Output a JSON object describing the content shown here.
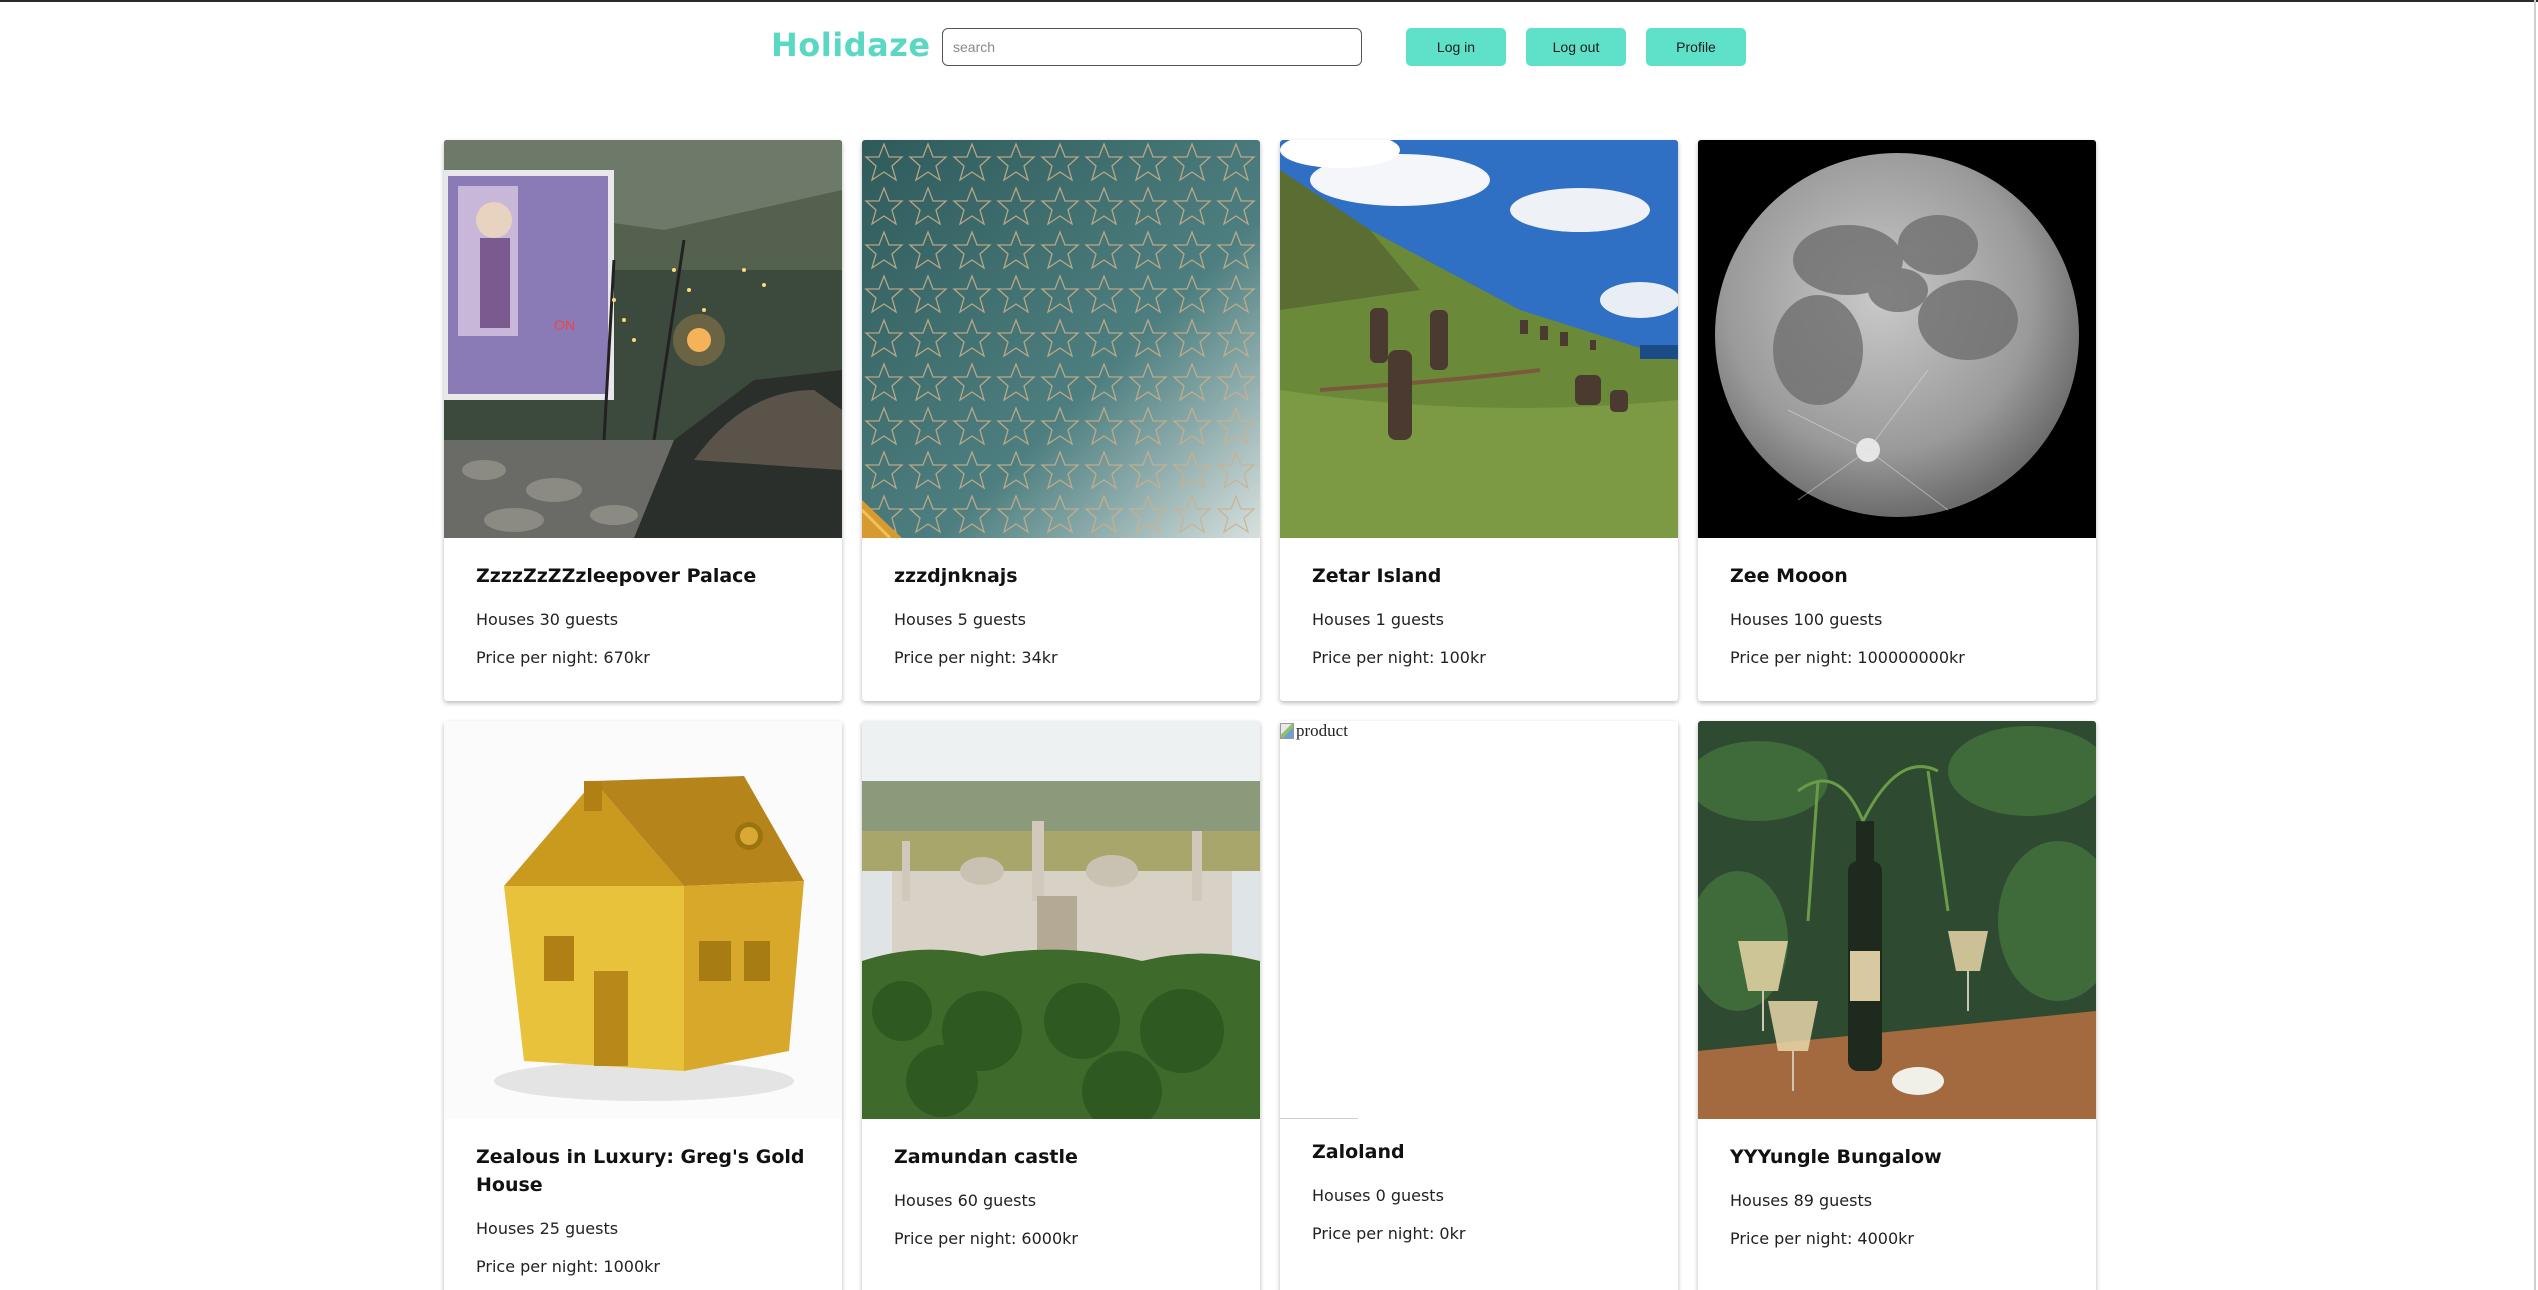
{
  "header": {
    "logo": "Holidaze",
    "search_placeholder": "search",
    "buttons": {
      "login": "Log in",
      "logout": "Log out",
      "profile": "Profile"
    }
  },
  "colors": {
    "brand": "#5ad8c4",
    "button": "#5ee0c9"
  },
  "cards": [
    {
      "title": "ZzzzZzZZzleepover Palace",
      "guests": "Houses 30 guests",
      "price": "Price per night: 670kr",
      "image": "outdoor-cinema-photo"
    },
    {
      "title": "zzzdjnknajs",
      "guests": "Houses 5 guests",
      "price": "Price per night: 34kr",
      "image": "star-pattern-wallpaper-photo"
    },
    {
      "title": "Zetar Island",
      "guests": "Houses 1 guests",
      "price": "Price per night: 100kr",
      "image": "moai-hillside-photo"
    },
    {
      "title": "Zee Mooon",
      "guests": "Houses 100 guests",
      "price": "Price per night: 100000000kr",
      "image": "full-moon-photo"
    },
    {
      "title": "Zealous in Luxury: Greg's Gold House",
      "guests": "Houses 25 guests",
      "price": "Price per night: 1000kr",
      "image": "gold-house-photo"
    },
    {
      "title": "Zamundan castle",
      "guests": "Houses 60 guests",
      "price": "Price per night: 6000kr",
      "image": "palace-forest-photo"
    },
    {
      "title": "Zaloland",
      "guests": "Houses 0 guests",
      "price": "Price per night: 0kr",
      "image": "broken-image",
      "alt": "product"
    },
    {
      "title": "YYYungle Bungalow",
      "guests": "Houses 89 guests",
      "price": "Price per night: 4000kr",
      "image": "champagne-jungle-photo"
    }
  ]
}
